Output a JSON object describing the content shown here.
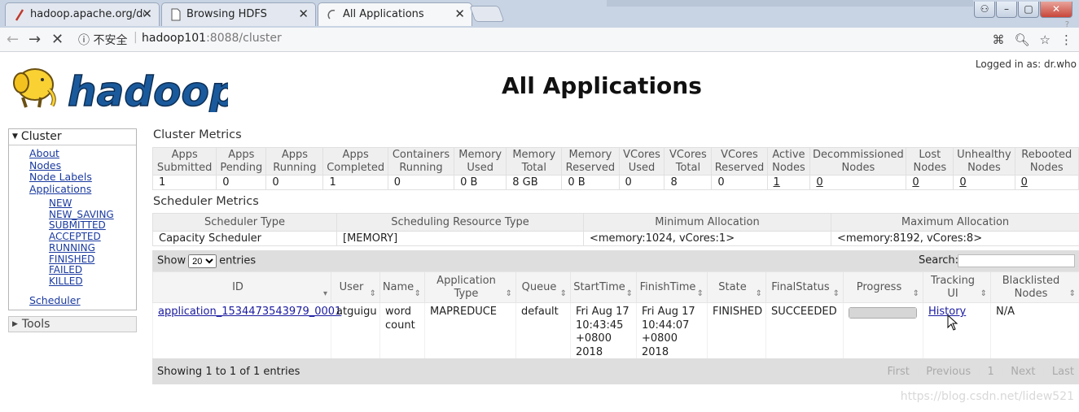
{
  "browser": {
    "tabs": [
      {
        "title": "hadoop.apache.org/do",
        "favicon": "feather-icon"
      },
      {
        "title": "Browsing HDFS",
        "favicon": "page-icon"
      },
      {
        "title": "All Applications",
        "favicon": "loading-icon"
      }
    ],
    "close_glyph": "✕",
    "window_buttons": [
      "user-icon",
      "minimize-icon",
      "maximize-icon",
      "close-icon"
    ],
    "security_label": "不安全",
    "url_host": "hadoop101",
    "url_rest": ":8088/cluster",
    "scroll_hint": "?"
  },
  "header": {
    "logged_in": "Logged in as: dr.who",
    "page_title": "All Applications",
    "logo_text": "hadoop"
  },
  "sidebar": {
    "cluster_label": "Cluster",
    "cluster_links": [
      "About",
      "Nodes",
      "Node Labels",
      "Applications"
    ],
    "app_states": [
      "NEW",
      "NEW_SAVING",
      "SUBMITTED",
      "ACCEPTED",
      "RUNNING",
      "FINISHED",
      "FAILED",
      "KILLED"
    ],
    "scheduler_label": "Scheduler",
    "tools_label": "Tools"
  },
  "cluster_metrics": {
    "title": "Cluster Metrics",
    "headers": [
      [
        "Apps",
        "Submitted"
      ],
      [
        "Apps",
        "Pending"
      ],
      [
        "Apps",
        "Running"
      ],
      [
        "Apps",
        "Completed"
      ],
      [
        "Containers",
        "Running"
      ],
      [
        "Memory",
        "Used"
      ],
      [
        "Memory",
        "Total"
      ],
      [
        "Memory",
        "Reserved"
      ],
      [
        "VCores",
        "Used"
      ],
      [
        "VCores",
        "Total"
      ],
      [
        "VCores",
        "Reserved"
      ],
      [
        "Active",
        "Nodes"
      ],
      [
        "Decommissioned",
        "Nodes"
      ],
      [
        "Lost",
        "Nodes"
      ],
      [
        "Unhealthy",
        "Nodes"
      ],
      [
        "Rebooted",
        "Nodes"
      ]
    ],
    "values": [
      "1",
      "0",
      "0",
      "1",
      "0",
      "0 B",
      "8 GB",
      "0 B",
      "0",
      "8",
      "0",
      "1",
      "0",
      "0",
      "0",
      "0"
    ]
  },
  "scheduler_metrics": {
    "title": "Scheduler Metrics",
    "headers": [
      "Scheduler Type",
      "Scheduling Resource Type",
      "Minimum Allocation",
      "Maximum Allocation"
    ],
    "values": [
      "Capacity Scheduler",
      "[MEMORY]",
      "<memory:1024, vCores:1>",
      "<memory:8192, vCores:8>"
    ]
  },
  "applications": {
    "show_label": "Show",
    "entries_label": "entries",
    "page_size": "20",
    "search_label": "Search:",
    "columns": [
      {
        "label": "ID",
        "sort": "▾"
      },
      {
        "label": "User",
        "sort": "⇕"
      },
      {
        "label": "Name",
        "sort": "⇕"
      },
      {
        "label": "Application Type",
        "sort": "⇕"
      },
      {
        "label": "Queue",
        "sort": "⇕"
      },
      {
        "label": "StartTime",
        "sort": "⇕"
      },
      {
        "label": "FinishTime",
        "sort": "⇕"
      },
      {
        "label": "State",
        "sort": "⇕"
      },
      {
        "label": "FinalStatus",
        "sort": "⇕"
      },
      {
        "label": "Progress",
        "sort": "⇕"
      },
      {
        "label": "Tracking UI",
        "sort": "⇕"
      },
      {
        "label": "Blacklisted Nodes",
        "sort": "⇕"
      }
    ],
    "rows": [
      {
        "id": "application_1534473543979_0001",
        "user": "atguigu",
        "name": "word count",
        "type": "MAPREDUCE",
        "queue": "default",
        "start": "Fri Aug 17 10:43:45 +0800 2018",
        "finish": "Fri Aug 17 10:44:07 +0800 2018",
        "state": "FINISHED",
        "final_status": "SUCCEEDED",
        "progress": 1.0,
        "tracking_ui": "History",
        "blacklisted": "N/A"
      }
    ],
    "info": "Showing 1 to 1 of 1 entries",
    "pager": [
      "First",
      "Previous",
      "1",
      "Next",
      "Last"
    ]
  },
  "watermark": "https://blog.csdn.net/lidew521"
}
